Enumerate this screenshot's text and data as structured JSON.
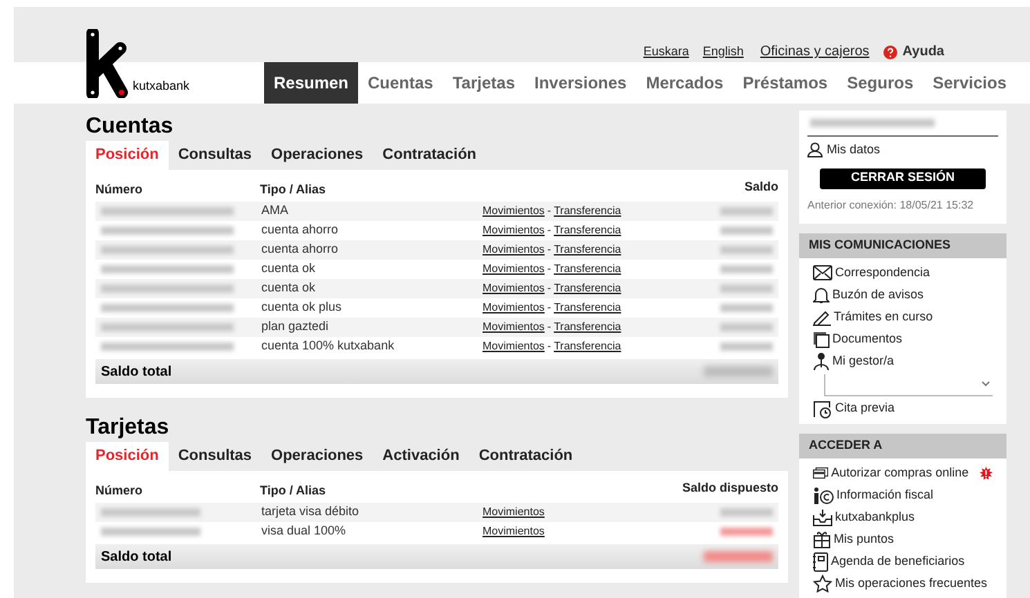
{
  "header": {
    "logo_text": "kutxabank",
    "top_links": [
      {
        "label": "Euskara",
        "kind": "link"
      },
      {
        "label": "English",
        "kind": "link"
      },
      {
        "label": "Oficinas y cajeros",
        "kind": "link"
      },
      {
        "label": "Ayuda",
        "kind": "help"
      }
    ],
    "nav": [
      {
        "label": "Resumen",
        "selected": true
      },
      {
        "label": "Cuentas",
        "selected": false
      },
      {
        "label": "Tarjetas",
        "selected": false
      },
      {
        "label": "Inversiones",
        "selected": false
      },
      {
        "label": "Mercados",
        "selected": false
      },
      {
        "label": "Préstamos",
        "selected": false
      },
      {
        "label": "Seguros",
        "selected": false
      },
      {
        "label": "Servicios",
        "selected": false
      }
    ]
  },
  "sections": [
    {
      "title": "Cuentas",
      "tabs": [
        {
          "label": "Posición",
          "selected": true
        },
        {
          "label": "Consultas",
          "selected": false
        },
        {
          "label": "Operaciones",
          "selected": false
        },
        {
          "label": "Contratación",
          "selected": false
        }
      ],
      "columns": [
        "Número",
        "Tipo / Alias",
        "Saldo"
      ],
      "link_separator": "-",
      "rows": [
        {
          "alias": "AMA",
          "links": [
            "Movimientos",
            "Transferencia"
          ],
          "negative": false
        },
        {
          "alias": "cuenta ahorro",
          "links": [
            "Movimientos",
            "Transferencia"
          ],
          "negative": false
        },
        {
          "alias": "cuenta ahorro",
          "links": [
            "Movimientos",
            "Transferencia"
          ],
          "negative": false
        },
        {
          "alias": "cuenta ok",
          "links": [
            "Movimientos",
            "Transferencia"
          ],
          "negative": false
        },
        {
          "alias": "cuenta ok",
          "links": [
            "Movimientos",
            "Transferencia"
          ],
          "negative": false
        },
        {
          "alias": "cuenta ok plus",
          "links": [
            "Movimientos",
            "Transferencia"
          ],
          "negative": false
        },
        {
          "alias": "plan gaztedi",
          "links": [
            "Movimientos",
            "Transferencia"
          ],
          "negative": false
        },
        {
          "alias": "cuenta 100% kutxabank",
          "links": [
            "Movimientos",
            "Transferencia"
          ],
          "negative": false
        }
      ],
      "total_label": "Saldo total",
      "total_negative": false
    },
    {
      "title": "Tarjetas",
      "tabs": [
        {
          "label": "Posición",
          "selected": true
        },
        {
          "label": "Consultas",
          "selected": false
        },
        {
          "label": "Operaciones",
          "selected": false
        },
        {
          "label": "Activación",
          "selected": false
        },
        {
          "label": "Contratación",
          "selected": false
        }
      ],
      "columns": [
        "Número",
        "Tipo / Alias",
        "Saldo dispuesto"
      ],
      "rows": [
        {
          "alias": "tarjeta visa débito",
          "links": [
            "Movimientos"
          ],
          "negative": false
        },
        {
          "alias": "visa dual 100%",
          "links": [
            "Movimientos"
          ],
          "negative": true
        }
      ],
      "total_label": "Saldo total",
      "total_negative": true
    }
  ],
  "sidebar": {
    "user": {
      "my_data": "Mis datos",
      "logout": "CERRAR SESIÓN",
      "last_login": "Anterior conexión: 18/05/21 15:32"
    },
    "panels": [
      {
        "title": "MIS COMUNICACIONES",
        "items": [
          {
            "label": "Correspondencia",
            "kind": "mail"
          },
          {
            "label": "Buzón de avisos",
            "kind": "bell"
          },
          {
            "label": "Trámites en curso",
            "kind": "pen"
          },
          {
            "label": "Documentos",
            "kind": "docs"
          },
          {
            "label": "Mi gestor/a",
            "kind": "person"
          },
          {
            "kind": "select"
          },
          {
            "label": "Cita previa",
            "kind": "calendar"
          }
        ]
      },
      {
        "title": "ACCEDER A",
        "items": [
          {
            "label": "Autorizar compras online",
            "kind": "card",
            "alert": true
          },
          {
            "label": "Información fiscal",
            "kind": "fiscal",
            "alert": false
          },
          {
            "label": "kutxabankplus",
            "kind": "box",
            "alert": false
          },
          {
            "label": "Mis puntos",
            "kind": "gift",
            "alert": false
          },
          {
            "label": "Agenda de beneficiarios",
            "kind": "book",
            "alert": false
          },
          {
            "label": "Mis operaciones frecuentes",
            "kind": "star",
            "alert": false
          }
        ]
      }
    ]
  }
}
